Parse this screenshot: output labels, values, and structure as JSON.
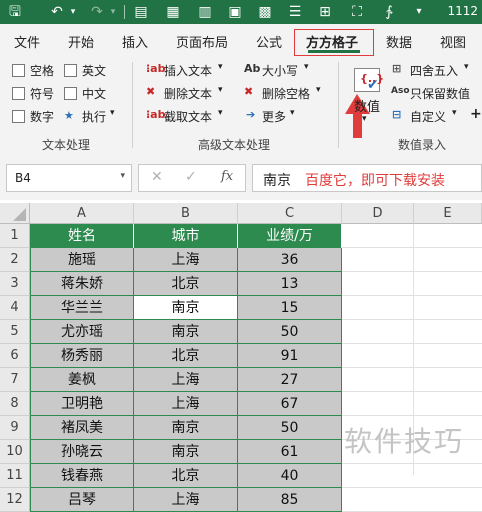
{
  "title_bar": {
    "number": "1112"
  },
  "tabs": [
    "文件",
    "开始",
    "插入",
    "页面布局",
    "公式",
    "方方格子",
    "数据",
    "视图"
  ],
  "ribbon": {
    "text_processing": {
      "checkboxes": [
        "空格",
        "英文",
        "符号",
        "中文",
        "数字"
      ],
      "execute": "执行",
      "group_label": "文本处理"
    },
    "advanced": {
      "insert_text": "插入文本",
      "delete_text": "删除文本",
      "extract_text": "截取文本",
      "case": "大小写",
      "delete_spaces": "删除空格",
      "more": "更多",
      "group_label": "高级文本处理"
    },
    "numeric": {
      "value_button": "数值",
      "round": "四舍五入",
      "keep_values": "只保留数值",
      "custom": "自定义",
      "group_label": "数值录入"
    }
  },
  "formula_bar": {
    "cell_ref": "B4",
    "content": "南京",
    "annotation": "百度它，即可下载安装"
  },
  "columns": [
    "A",
    "B",
    "C",
    "D",
    "E"
  ],
  "row_numbers": [
    "1",
    "2",
    "3",
    "4",
    "5",
    "6",
    "7",
    "8",
    "9",
    "10",
    "11",
    "12"
  ],
  "table": {
    "headers": [
      "姓名",
      "城市",
      "业绩/万"
    ],
    "rows": [
      [
        "施瑶",
        "上海",
        "36"
      ],
      [
        "蒋朱娇",
        "北京",
        "13"
      ],
      [
        "华兰兰",
        "南京",
        "15"
      ],
      [
        "尤亦瑶",
        "南京",
        "50"
      ],
      [
        "杨秀丽",
        "北京",
        "91"
      ],
      [
        "姜枫",
        "上海",
        "27"
      ],
      [
        "卫明艳",
        "上海",
        "67"
      ],
      [
        "褚凤美",
        "南京",
        "50"
      ],
      [
        "孙晓云",
        "南京",
        "61"
      ],
      [
        "钱春燕",
        "北京",
        "40"
      ],
      [
        "吕琴",
        "上海",
        "85"
      ]
    ]
  },
  "watermark": "软件技巧",
  "colors": {
    "excel_green": "#217346",
    "header_fill": "#2e8b4f",
    "data_fill": "#c9c9c9",
    "annotation_red": "#e03c3c"
  }
}
